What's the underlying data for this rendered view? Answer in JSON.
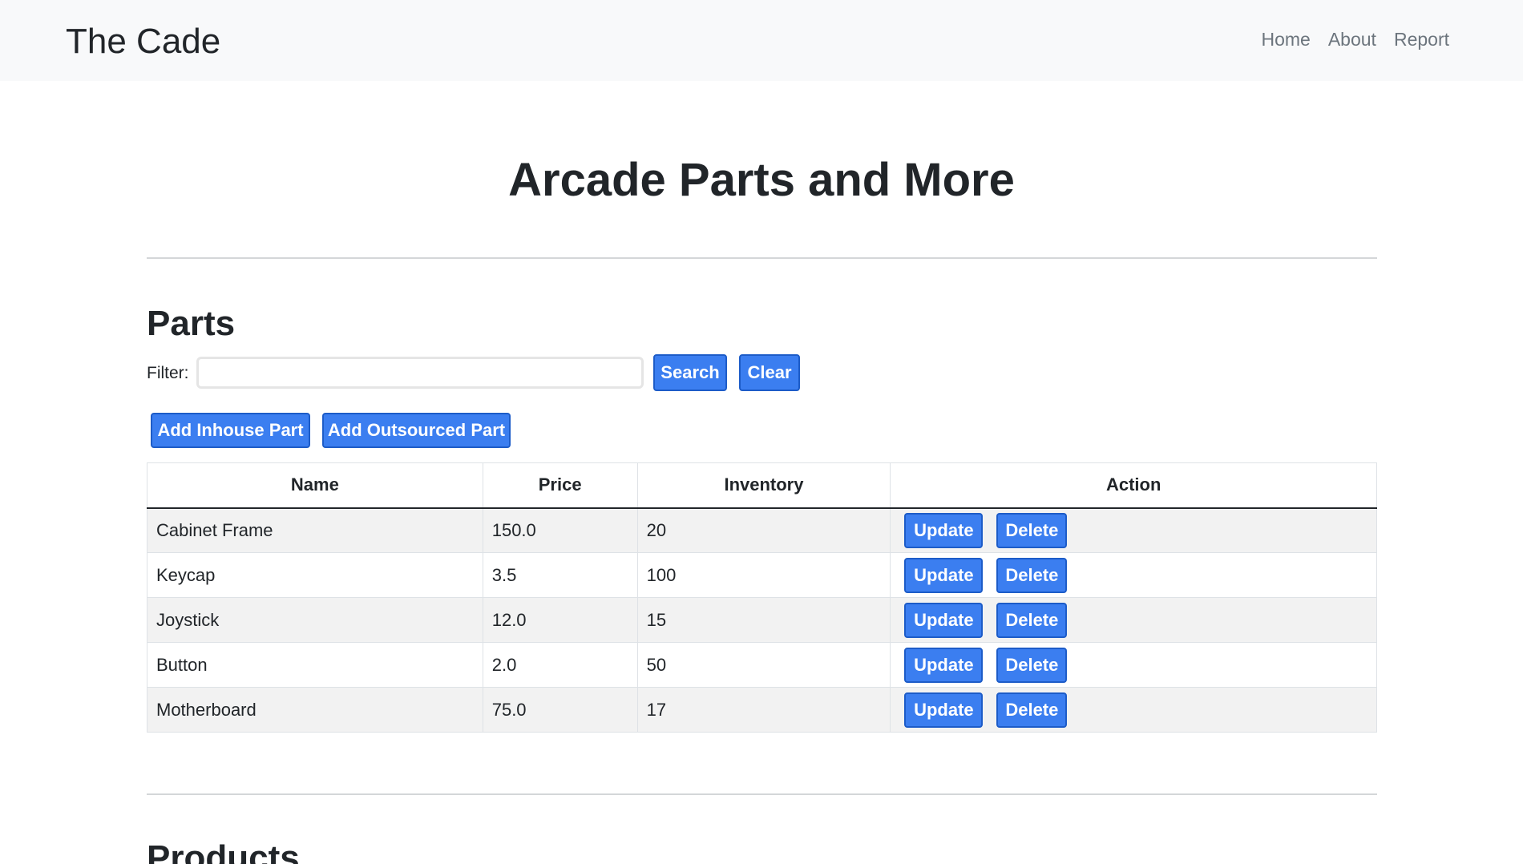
{
  "navbar": {
    "brand": "The Cade",
    "links": [
      "Home",
      "About",
      "Report"
    ]
  },
  "hero": {
    "title": "Arcade Parts and More"
  },
  "parts": {
    "title": "Parts",
    "filter_label": "Filter:",
    "filter_value": "",
    "filter_placeholder": "",
    "search_label": "Search",
    "clear_label": "Clear",
    "add_inhouse_label": "Add Inhouse Part",
    "add_outsourced_label": "Add Outsourced Part",
    "columns": [
      "Name",
      "Price",
      "Inventory",
      "Action"
    ],
    "rows": [
      {
        "name": "Cabinet Frame",
        "price": "150.0",
        "inventory": "20"
      },
      {
        "name": "Keycap",
        "price": "3.5",
        "inventory": "100"
      },
      {
        "name": "Joystick",
        "price": "12.0",
        "inventory": "15"
      },
      {
        "name": "Button",
        "price": "2.0",
        "inventory": "50"
      },
      {
        "name": "Motherboard",
        "price": "75.0",
        "inventory": "17"
      }
    ],
    "update_label": "Update",
    "delete_label": "Delete"
  },
  "products": {
    "title": "Products"
  },
  "colors": {
    "primary": "#3b7ef0",
    "navbar_bg": "#f8f9fa",
    "stripe": "#f2f2f2"
  }
}
